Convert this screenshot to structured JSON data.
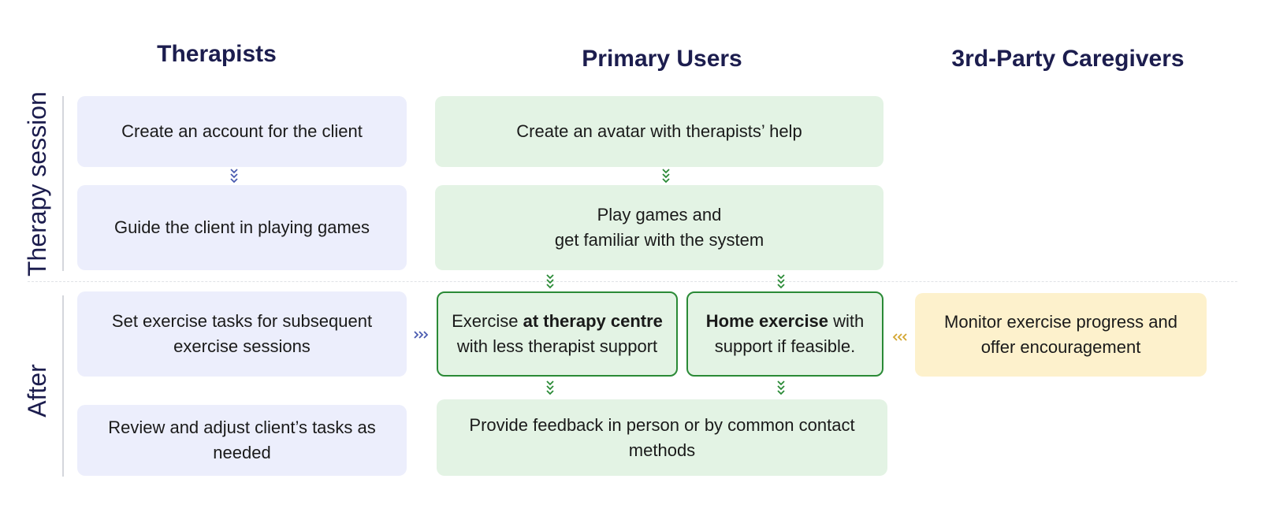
{
  "headers": {
    "therapists": "Therapists",
    "primary_users": "Primary Users",
    "caregivers": "3rd-Party Caregivers"
  },
  "rows": {
    "therapy_session": "Therapy session",
    "after": "After"
  },
  "therapists": {
    "create_account": "Create an account for the client",
    "guide_games": "Guide the client in playing games",
    "set_tasks": "Set exercise tasks for subsequent exercise sessions",
    "review_tasks": "Review and adjust client’s tasks as needed"
  },
  "primary_users": {
    "create_avatar": "Create an avatar with therapists’ help",
    "play_games_line1": "Play games and",
    "play_games_line2": "get familiar with the system",
    "centre_pre": "Exercise ",
    "centre_bold": "at therapy centre",
    "centre_post": "with less therapist support",
    "home_bold": "Home exercise",
    "home_post1": " with",
    "home_post2": "support if feasible.",
    "feedback": "Provide feedback in person or by common contact methods"
  },
  "caregivers": {
    "monitor": "Monitor exercise progress and offer encouragement"
  },
  "colors": {
    "header_text": "#1c1d4e",
    "therapist_box": "#eceefc",
    "primary_box": "#e3f3e4",
    "primary_border": "#2a8a36",
    "caregiver_box": "#fdf1cc",
    "arrow_blue": "#4a5bb0",
    "arrow_green": "#2a8a36",
    "arrow_yellow": "#d3a631"
  }
}
